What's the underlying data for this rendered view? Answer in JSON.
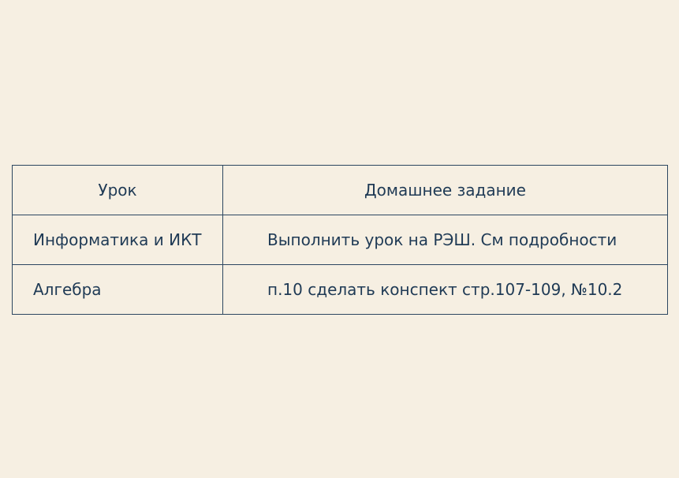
{
  "table": {
    "headers": {
      "lesson": "Урок",
      "homework": "Домашнее задание"
    },
    "rows": [
      {
        "lesson": "Информатика и ИКТ",
        "homework": "Выполнить урок на РЭШ. См подробности"
      },
      {
        "lesson": "Алгебра",
        "homework": "п.10 сделать конспект стр.107-109, №10.2"
      }
    ]
  },
  "colors": {
    "background": "#f6efe2",
    "text": "#1f3a55",
    "border": "#2c4660"
  }
}
